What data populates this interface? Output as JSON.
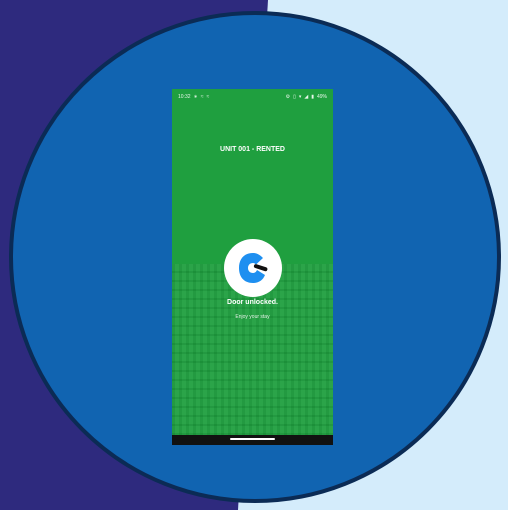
{
  "status_bar": {
    "time": "10:32",
    "left_icons": [
      "bluetooth-icon",
      "notification-icon",
      "notification-icon"
    ],
    "right_icons": [
      "settings-icon",
      "vibrate-icon",
      "wifi-icon",
      "signal-icon",
      "battery-icon"
    ],
    "battery": "49%"
  },
  "screen": {
    "title": "UNIT 001 - RENTED",
    "message": "Door unlocked.",
    "submessage": "Enjoy your stay",
    "lock_icon": "door-lock-icon"
  },
  "colors": {
    "screen_background": "#1f9f3f",
    "outer_circle": "#1164b1",
    "circle_border": "#0b2b55",
    "left_background": "#2e2a7e",
    "right_background": "#d4ecfb",
    "lock_accent": "#1e8ff0"
  }
}
